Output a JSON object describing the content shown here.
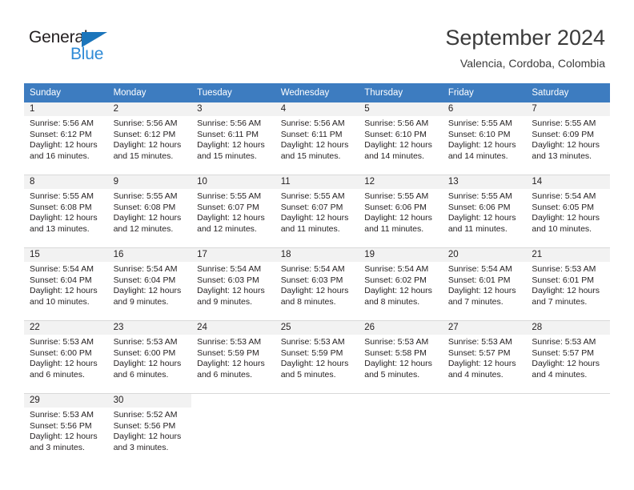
{
  "brand": {
    "name_top": "General",
    "name_bottom": "Blue",
    "triangle_color": "#1b75bb",
    "blue_text_color": "#2e8ad6"
  },
  "header": {
    "title": "September 2024",
    "location": "Valencia, Cordoba, Colombia",
    "header_bg": "#3d7cc0",
    "header_text_color": "#ffffff"
  },
  "weekdays": [
    "Sunday",
    "Monday",
    "Tuesday",
    "Wednesday",
    "Thursday",
    "Friday",
    "Saturday"
  ],
  "weeks": [
    [
      {
        "day": "1",
        "sunrise": "Sunrise: 5:56 AM",
        "sunset": "Sunset: 6:12 PM",
        "daylight_1": "Daylight: 12 hours",
        "daylight_2": "and 16 minutes."
      },
      {
        "day": "2",
        "sunrise": "Sunrise: 5:56 AM",
        "sunset": "Sunset: 6:12 PM",
        "daylight_1": "Daylight: 12 hours",
        "daylight_2": "and 15 minutes."
      },
      {
        "day": "3",
        "sunrise": "Sunrise: 5:56 AM",
        "sunset": "Sunset: 6:11 PM",
        "daylight_1": "Daylight: 12 hours",
        "daylight_2": "and 15 minutes."
      },
      {
        "day": "4",
        "sunrise": "Sunrise: 5:56 AM",
        "sunset": "Sunset: 6:11 PM",
        "daylight_1": "Daylight: 12 hours",
        "daylight_2": "and 15 minutes."
      },
      {
        "day": "5",
        "sunrise": "Sunrise: 5:56 AM",
        "sunset": "Sunset: 6:10 PM",
        "daylight_1": "Daylight: 12 hours",
        "daylight_2": "and 14 minutes."
      },
      {
        "day": "6",
        "sunrise": "Sunrise: 5:55 AM",
        "sunset": "Sunset: 6:10 PM",
        "daylight_1": "Daylight: 12 hours",
        "daylight_2": "and 14 minutes."
      },
      {
        "day": "7",
        "sunrise": "Sunrise: 5:55 AM",
        "sunset": "Sunset: 6:09 PM",
        "daylight_1": "Daylight: 12 hours",
        "daylight_2": "and 13 minutes."
      }
    ],
    [
      {
        "day": "8",
        "sunrise": "Sunrise: 5:55 AM",
        "sunset": "Sunset: 6:08 PM",
        "daylight_1": "Daylight: 12 hours",
        "daylight_2": "and 13 minutes."
      },
      {
        "day": "9",
        "sunrise": "Sunrise: 5:55 AM",
        "sunset": "Sunset: 6:08 PM",
        "daylight_1": "Daylight: 12 hours",
        "daylight_2": "and 12 minutes."
      },
      {
        "day": "10",
        "sunrise": "Sunrise: 5:55 AM",
        "sunset": "Sunset: 6:07 PM",
        "daylight_1": "Daylight: 12 hours",
        "daylight_2": "and 12 minutes."
      },
      {
        "day": "11",
        "sunrise": "Sunrise: 5:55 AM",
        "sunset": "Sunset: 6:07 PM",
        "daylight_1": "Daylight: 12 hours",
        "daylight_2": "and 11 minutes."
      },
      {
        "day": "12",
        "sunrise": "Sunrise: 5:55 AM",
        "sunset": "Sunset: 6:06 PM",
        "daylight_1": "Daylight: 12 hours",
        "daylight_2": "and 11 minutes."
      },
      {
        "day": "13",
        "sunrise": "Sunrise: 5:55 AM",
        "sunset": "Sunset: 6:06 PM",
        "daylight_1": "Daylight: 12 hours",
        "daylight_2": "and 11 minutes."
      },
      {
        "day": "14",
        "sunrise": "Sunrise: 5:54 AM",
        "sunset": "Sunset: 6:05 PM",
        "daylight_1": "Daylight: 12 hours",
        "daylight_2": "and 10 minutes."
      }
    ],
    [
      {
        "day": "15",
        "sunrise": "Sunrise: 5:54 AM",
        "sunset": "Sunset: 6:04 PM",
        "daylight_1": "Daylight: 12 hours",
        "daylight_2": "and 10 minutes."
      },
      {
        "day": "16",
        "sunrise": "Sunrise: 5:54 AM",
        "sunset": "Sunset: 6:04 PM",
        "daylight_1": "Daylight: 12 hours",
        "daylight_2": "and 9 minutes."
      },
      {
        "day": "17",
        "sunrise": "Sunrise: 5:54 AM",
        "sunset": "Sunset: 6:03 PM",
        "daylight_1": "Daylight: 12 hours",
        "daylight_2": "and 9 minutes."
      },
      {
        "day": "18",
        "sunrise": "Sunrise: 5:54 AM",
        "sunset": "Sunset: 6:03 PM",
        "daylight_1": "Daylight: 12 hours",
        "daylight_2": "and 8 minutes."
      },
      {
        "day": "19",
        "sunrise": "Sunrise: 5:54 AM",
        "sunset": "Sunset: 6:02 PM",
        "daylight_1": "Daylight: 12 hours",
        "daylight_2": "and 8 minutes."
      },
      {
        "day": "20",
        "sunrise": "Sunrise: 5:54 AM",
        "sunset": "Sunset: 6:01 PM",
        "daylight_1": "Daylight: 12 hours",
        "daylight_2": "and 7 minutes."
      },
      {
        "day": "21",
        "sunrise": "Sunrise: 5:53 AM",
        "sunset": "Sunset: 6:01 PM",
        "daylight_1": "Daylight: 12 hours",
        "daylight_2": "and 7 minutes."
      }
    ],
    [
      {
        "day": "22",
        "sunrise": "Sunrise: 5:53 AM",
        "sunset": "Sunset: 6:00 PM",
        "daylight_1": "Daylight: 12 hours",
        "daylight_2": "and 6 minutes."
      },
      {
        "day": "23",
        "sunrise": "Sunrise: 5:53 AM",
        "sunset": "Sunset: 6:00 PM",
        "daylight_1": "Daylight: 12 hours",
        "daylight_2": "and 6 minutes."
      },
      {
        "day": "24",
        "sunrise": "Sunrise: 5:53 AM",
        "sunset": "Sunset: 5:59 PM",
        "daylight_1": "Daylight: 12 hours",
        "daylight_2": "and 6 minutes."
      },
      {
        "day": "25",
        "sunrise": "Sunrise: 5:53 AM",
        "sunset": "Sunset: 5:59 PM",
        "daylight_1": "Daylight: 12 hours",
        "daylight_2": "and 5 minutes."
      },
      {
        "day": "26",
        "sunrise": "Sunrise: 5:53 AM",
        "sunset": "Sunset: 5:58 PM",
        "daylight_1": "Daylight: 12 hours",
        "daylight_2": "and 5 minutes."
      },
      {
        "day": "27",
        "sunrise": "Sunrise: 5:53 AM",
        "sunset": "Sunset: 5:57 PM",
        "daylight_1": "Daylight: 12 hours",
        "daylight_2": "and 4 minutes."
      },
      {
        "day": "28",
        "sunrise": "Sunrise: 5:53 AM",
        "sunset": "Sunset: 5:57 PM",
        "daylight_1": "Daylight: 12 hours",
        "daylight_2": "and 4 minutes."
      }
    ],
    [
      {
        "day": "29",
        "sunrise": "Sunrise: 5:53 AM",
        "sunset": "Sunset: 5:56 PM",
        "daylight_1": "Daylight: 12 hours",
        "daylight_2": "and 3 minutes."
      },
      {
        "day": "30",
        "sunrise": "Sunrise: 5:52 AM",
        "sunset": "Sunset: 5:56 PM",
        "daylight_1": "Daylight: 12 hours",
        "daylight_2": "and 3 minutes."
      },
      {
        "day": "",
        "sunrise": "",
        "sunset": "",
        "daylight_1": "",
        "daylight_2": ""
      },
      {
        "day": "",
        "sunrise": "",
        "sunset": "",
        "daylight_1": "",
        "daylight_2": ""
      },
      {
        "day": "",
        "sunrise": "",
        "sunset": "",
        "daylight_1": "",
        "daylight_2": ""
      },
      {
        "day": "",
        "sunrise": "",
        "sunset": "",
        "daylight_1": "",
        "daylight_2": ""
      },
      {
        "day": "",
        "sunrise": "",
        "sunset": "",
        "daylight_1": "",
        "daylight_2": ""
      }
    ]
  ]
}
